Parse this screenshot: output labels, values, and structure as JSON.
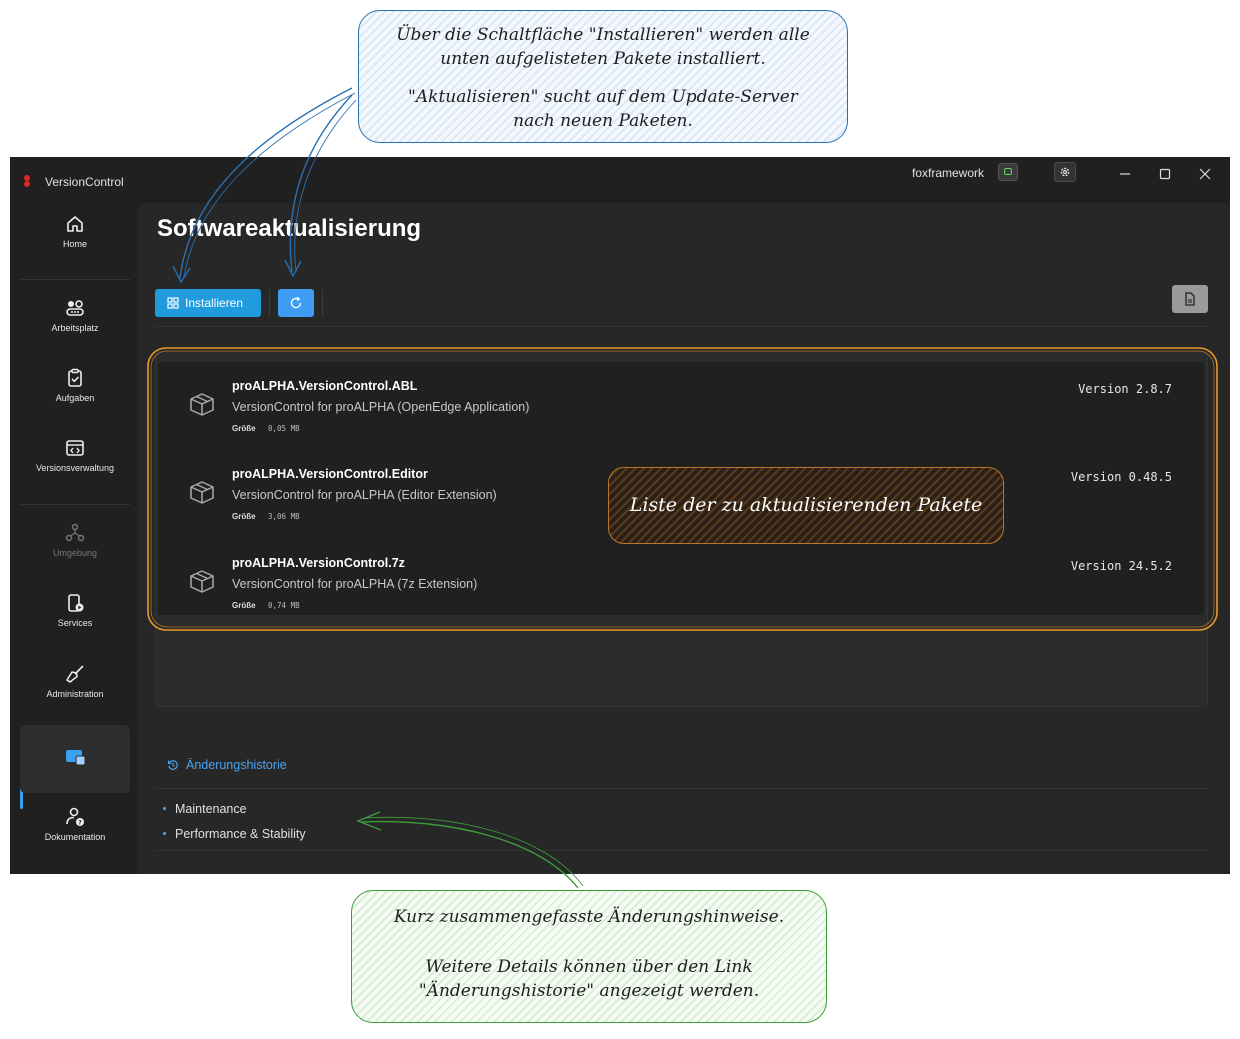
{
  "callouts": {
    "top_line1": "Über die Schaltfläche \"Installieren\" werden alle",
    "top_line2": "unten aufgelisteten Pakete installiert.",
    "top_line3": "\"Aktualisieren\" sucht auf dem Update-Server",
    "top_line4": "nach neuen Paketen.",
    "list": "Liste der zu aktualisierenden Pakete",
    "bottom_line1": "Kurz zusammengefasste Änderungshinweise.",
    "bottom_line2": "Weitere Details können über den Link",
    "bottom_line3": "\"Änderungshistorie\" angezeigt werden."
  },
  "app": {
    "title": "VersionControl",
    "user": "foxframework",
    "accent": "#1f9bde"
  },
  "sidebar": {
    "items": [
      {
        "label": "Home",
        "icon": "home-icon"
      },
      {
        "label": "Arbeitsplatz",
        "icon": "workspace-icon"
      },
      {
        "label": "Aufgaben",
        "icon": "tasks-icon"
      },
      {
        "label": "Versionsverwaltung",
        "icon": "version-control-icon"
      },
      {
        "label": "Umgebung",
        "icon": "environment-icon",
        "disabled": true
      },
      {
        "label": "Services",
        "icon": "services-icon"
      },
      {
        "label": "Administration",
        "icon": "administration-icon"
      },
      {
        "label": "",
        "icon": "software-update-icon",
        "active": true
      },
      {
        "label": "Dokumentation",
        "icon": "documentation-icon"
      }
    ]
  },
  "page": {
    "title": "Softwareaktualisierung",
    "install_label": "Installieren"
  },
  "packages": [
    {
      "name": "proALPHA.VersionControl.ABL",
      "description": "VersionControl for proALPHA (OpenEdge Application)",
      "size_label": "Größe",
      "size": "0,05 MB",
      "version": "Version 2.8.7"
    },
    {
      "name": "proALPHA.VersionControl.Editor",
      "description": "VersionControl for proALPHA (Editor Extension)",
      "size_label": "Größe",
      "size": "3,06 MB",
      "version": "Version 0.48.5"
    },
    {
      "name": "proALPHA.VersionControl.7z",
      "description": "VersionControl for proALPHA (7z Extension)",
      "size_label": "Größe",
      "size": "0,74 MB",
      "version": "Version 24.5.2"
    }
  ],
  "history": {
    "link_label": "Änderungshistorie",
    "items": [
      "Maintenance",
      "Performance & Stability"
    ]
  }
}
